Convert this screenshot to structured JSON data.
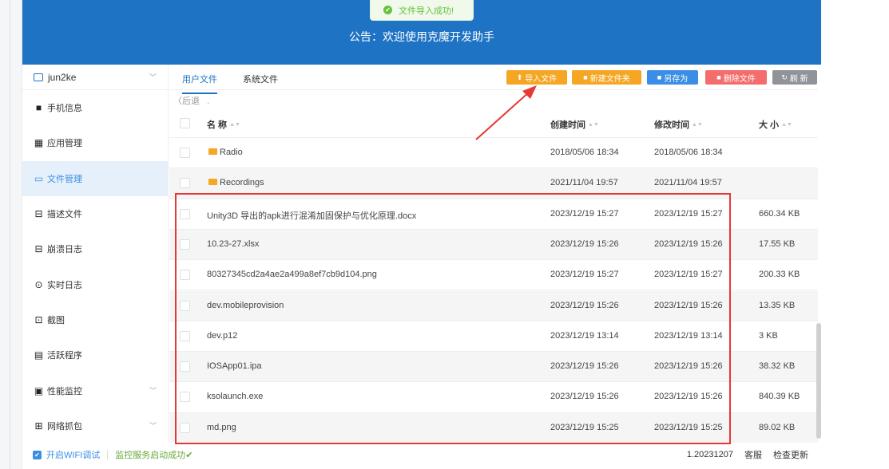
{
  "toast": {
    "icon": "success-check-icon",
    "message": "文件导入成功!"
  },
  "banner": {
    "notice": "公告：欢迎使用克魔开发助手"
  },
  "device": {
    "name": "jun2ke"
  },
  "sidebar": {
    "items": [
      {
        "label": "手机信息",
        "icon": "apple-icon"
      },
      {
        "label": "应用管理",
        "icon": "apps-icon"
      },
      {
        "label": "文件管理",
        "icon": "folder-icon",
        "active": true
      },
      {
        "label": "描述文件",
        "icon": "profile-icon"
      },
      {
        "label": "崩溃日志",
        "icon": "crash-log-icon"
      },
      {
        "label": "实时日志",
        "icon": "realtime-log-icon"
      },
      {
        "label": "截图",
        "icon": "screenshot-icon"
      },
      {
        "label": "活跃程序",
        "icon": "active-programs-icon"
      },
      {
        "label": "性能监控",
        "icon": "performance-icon",
        "expandable": true
      },
      {
        "label": "网络抓包",
        "icon": "packet-capture-icon",
        "expandable": true
      }
    ]
  },
  "tabs": {
    "user_files": "用户文件",
    "system_files": "系统文件"
  },
  "toolbar": {
    "import_label": "导入文件",
    "new_folder_label": "新建文件夹",
    "save_as_label": "另存为",
    "delete_label": "删除文件",
    "refresh_label": "刷 新"
  },
  "nav": {
    "back_label": "后退",
    "path": "."
  },
  "table": {
    "headers": {
      "name": "名 称",
      "created": "创建时间",
      "modified": "修改时间",
      "size": "大 小"
    },
    "rows": [
      {
        "name": "Radio",
        "folder": true,
        "created": "2018/05/06 18:34",
        "modified": "2018/05/06 18:34",
        "size": ""
      },
      {
        "name": "Recordings",
        "folder": true,
        "created": "2021/11/04 19:57",
        "modified": "2021/11/04 19:57",
        "size": ""
      },
      {
        "name": "Unity3D 导出的apk进行混淆加固保护与优化原理.docx",
        "folder": false,
        "created": "2023/12/19 15:27",
        "modified": "2023/12/19 15:27",
        "size": "660.34 KB"
      },
      {
        "name": "10.23-27.xlsx",
        "folder": false,
        "created": "2023/12/19 15:26",
        "modified": "2023/12/19 15:26",
        "size": "17.55 KB"
      },
      {
        "name": "80327345cd2a4ae2a499a8ef7cb9d104.png",
        "folder": false,
        "created": "2023/12/19 15:27",
        "modified": "2023/12/19 15:27",
        "size": "200.33 KB"
      },
      {
        "name": "dev.mobileprovision",
        "folder": false,
        "created": "2023/12/19 15:26",
        "modified": "2023/12/19 15:26",
        "size": "13.35 KB"
      },
      {
        "name": "dev.p12",
        "folder": false,
        "created": "2023/12/19 13:14",
        "modified": "2023/12/19 13:14",
        "size": "3 KB"
      },
      {
        "name": "IOSApp01.ipa",
        "folder": false,
        "created": "2023/12/19 15:26",
        "modified": "2023/12/19 15:26",
        "size": "38.32 KB"
      },
      {
        "name": "ksolaunch.exe",
        "folder": false,
        "created": "2023/12/19 15:26",
        "modified": "2023/12/19 15:26",
        "size": "840.39 KB"
      },
      {
        "name": "md.png",
        "folder": false,
        "created": "2023/12/19 15:25",
        "modified": "2023/12/19 15:25",
        "size": "89.02 KB"
      }
    ]
  },
  "status": {
    "wifi_debug_label": "开启WIFI调试",
    "monitor_status": "监控服务启动成功✔",
    "version": "1.20231207",
    "support_label": "客服",
    "update_label": "检查更新"
  },
  "colors": {
    "banner": "#1e73c5",
    "accent": "#3a8ee6",
    "orange": "#f5a623",
    "red": "#f56c6c",
    "highlight": "#e53935"
  }
}
